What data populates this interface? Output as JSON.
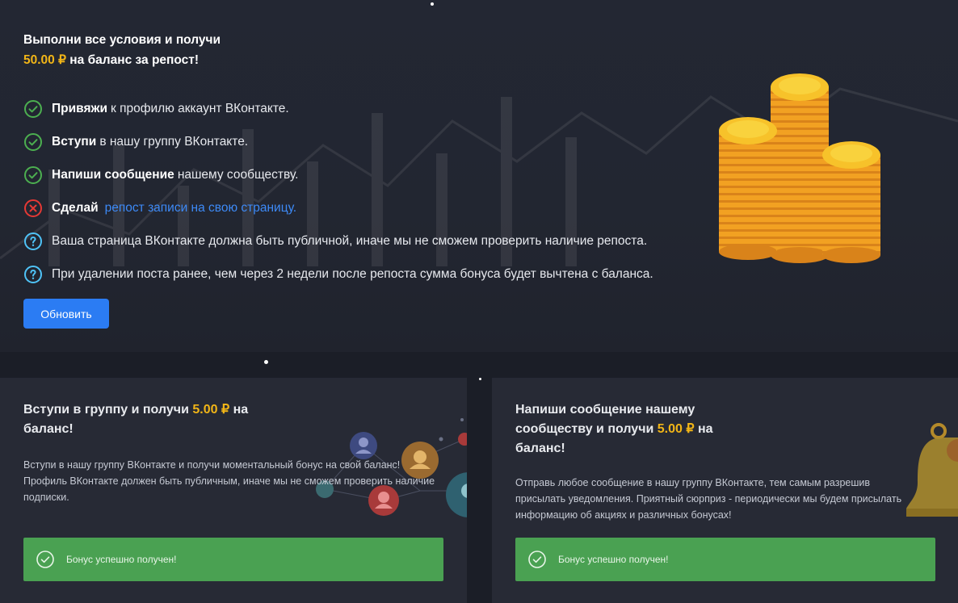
{
  "hero": {
    "title_line1": "Выполни все условия и получи",
    "amount": "50.00 ₽",
    "title_rest": " на баланс за репост!",
    "conditions": [
      {
        "status": "done",
        "bold": "Привяжи",
        "text": "к профилю аккаунт ВКонтакте."
      },
      {
        "status": "done",
        "bold": "Вступи",
        "text": "в нашу группу ВКонтакте."
      },
      {
        "status": "done",
        "bold": "Напиши сообщение",
        "text": "нашему сообществу."
      },
      {
        "status": "failed",
        "bold": "Сделай",
        "link": "репост записи на свою страницу."
      },
      {
        "status": "info",
        "text": "Ваша страница ВКонтакте должна быть публичной, иначе мы не сможем проверить наличие репоста."
      },
      {
        "status": "info",
        "text": "При удалении поста ранее, чем через 2 недели после репоста сумма бонуса будет вычтена с баланса."
      }
    ],
    "refresh_label": "Обновить"
  },
  "cards": [
    {
      "title_before": "Вступи в группу и получи ",
      "amount": "5.00 ₽",
      "title_after": " на баланс!",
      "description": "Вступи в нашу группу ВКонтакте и получи моментальный бонус на свой баланс! Профиль ВКонтакте должен быть публичным, иначе мы не сможем проверить наличие подписки.",
      "status_text": "Бонус успешно получен!"
    },
    {
      "title_before": "Напиши сообщение нашему сообществу и получи ",
      "amount": "5.00 ₽",
      "title_after": " на баланс!",
      "description": "Отправь любое сообщение в нашу группу ВКонтакте, тем самым разрешив присылать уведомления. Приятный сюрприз - периодически мы будем присылать информацию об акциях и различных бонусах!",
      "status_text": "Бонус успешно получен!"
    }
  ],
  "colors": {
    "accent_gold": "#f1b517",
    "accent_blue": "#2b7cf3",
    "link_blue": "#3d8af7",
    "success_green": "#4aa152",
    "done_icon": "#4caf50",
    "fail_icon": "#e53935",
    "info_icon": "#4fc3f7"
  }
}
